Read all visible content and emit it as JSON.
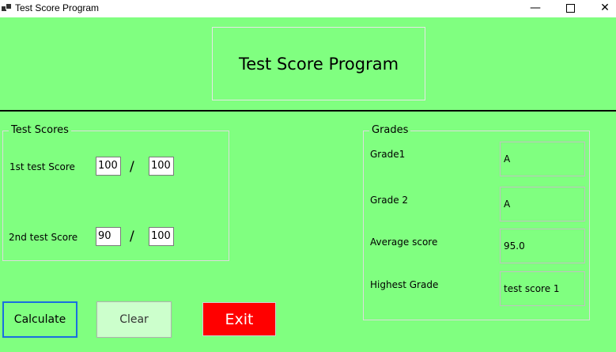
{
  "window": {
    "title": "Test Score Program",
    "minimize": "—",
    "close": "✕"
  },
  "header": {
    "title": "Test Score Program"
  },
  "scores": {
    "legend": "Test Scores",
    "test1": {
      "label": "1st test Score",
      "score": "100",
      "slash": "/",
      "max": "100"
    },
    "test2": {
      "label": "2nd test Score",
      "score": "90",
      "slash": "/",
      "max": "100"
    }
  },
  "grades": {
    "legend": "Grades",
    "grade1": {
      "label": "Grade1",
      "value": "A"
    },
    "grade2": {
      "label": "Grade 2",
      "value": "A"
    },
    "average": {
      "label": "Average score",
      "value": "95.0"
    },
    "highest": {
      "label": "Highest Grade",
      "value": "test score 1"
    }
  },
  "buttons": {
    "calculate": "Calculate",
    "clear": "Clear",
    "exit": "Exit"
  },
  "colors": {
    "background": "#80ff80",
    "exit": "#ff0000",
    "clear": "#ccffcc",
    "focus_border": "#1a6fe0"
  }
}
